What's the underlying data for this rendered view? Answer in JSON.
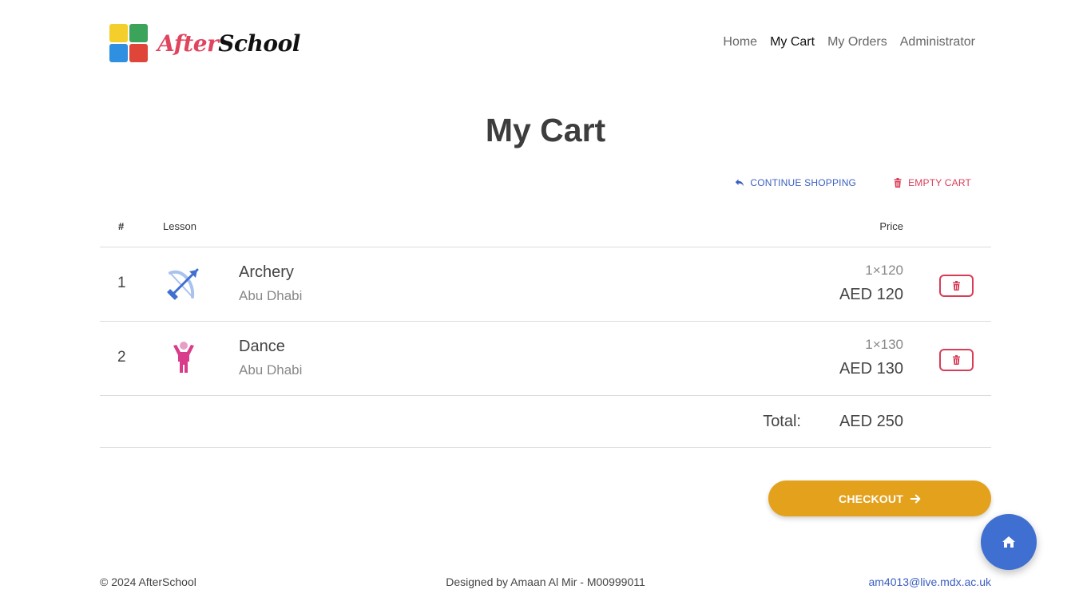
{
  "header": {
    "logo_text_part1": "After",
    "logo_text_part2": "School",
    "logo_colors": [
      "#f4cf2c",
      "#3ca35a",
      "#2f8fe0",
      "#e0453a"
    ],
    "nav": [
      {
        "label": "Home",
        "active": false
      },
      {
        "label": "My Cart",
        "active": true
      },
      {
        "label": "My Orders",
        "active": false
      },
      {
        "label": "Administrator",
        "active": false
      }
    ]
  },
  "page_title": "My Cart",
  "actions": {
    "continue_label": "CONTINUE SHOPPING",
    "continue_icon": "reply-arrow-icon",
    "empty_label": "EMPTY CART",
    "empty_icon": "trash-icon"
  },
  "table": {
    "headers": {
      "num": "#",
      "lesson": "Lesson",
      "price": "Price"
    },
    "rows": [
      {
        "num": "1",
        "icon": "archery-bow-icon",
        "name": "Archery",
        "location": "Abu Dhabi",
        "qty": "1×120",
        "price": "AED 120"
      },
      {
        "num": "2",
        "icon": "dance-person-icon",
        "name": "Dance",
        "location": "Abu Dhabi",
        "qty": "1×130",
        "price": "AED 130"
      }
    ],
    "total_label": "Total:",
    "total_value": "AED 250"
  },
  "checkout_label": "CHECKOUT",
  "footer": {
    "copyright": "© 2024 AfterSchool",
    "credit": "Designed by Amaan Al Mir - M00999011",
    "email": "am4013@live.mdx.ac.uk"
  },
  "colors": {
    "accent_blue": "#3b5fc0",
    "danger_red": "#d93c57",
    "checkout_orange": "#e3a11c",
    "fab_blue": "#3f6fd0"
  }
}
